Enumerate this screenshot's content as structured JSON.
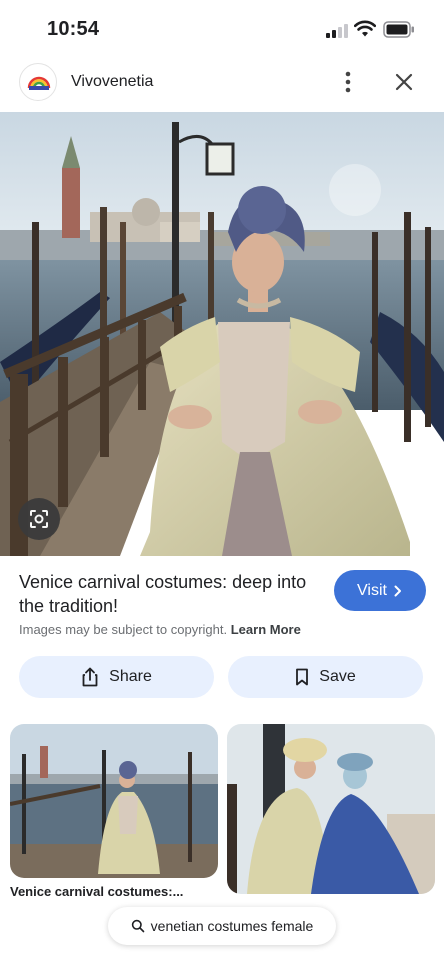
{
  "status_bar": {
    "time": "10:54"
  },
  "header": {
    "site_name": "Vivovenetia",
    "logo_icon": "vivovenetia-logo-icon"
  },
  "result": {
    "title": "Venice carnival costumes: deep into the tradition!",
    "visit_label": "Visit",
    "copyright_text": "Images may be subject to copyright.",
    "learn_more": "Learn More"
  },
  "actions": {
    "share_label": "Share",
    "save_label": "Save"
  },
  "related": {
    "caption": "Venice carnival costumes:..."
  },
  "query_chip": {
    "label": "venetian costumes female"
  },
  "colors": {
    "visit_blue": "#3c72d7",
    "action_bg": "#e8f0fe",
    "text": "#202124"
  }
}
